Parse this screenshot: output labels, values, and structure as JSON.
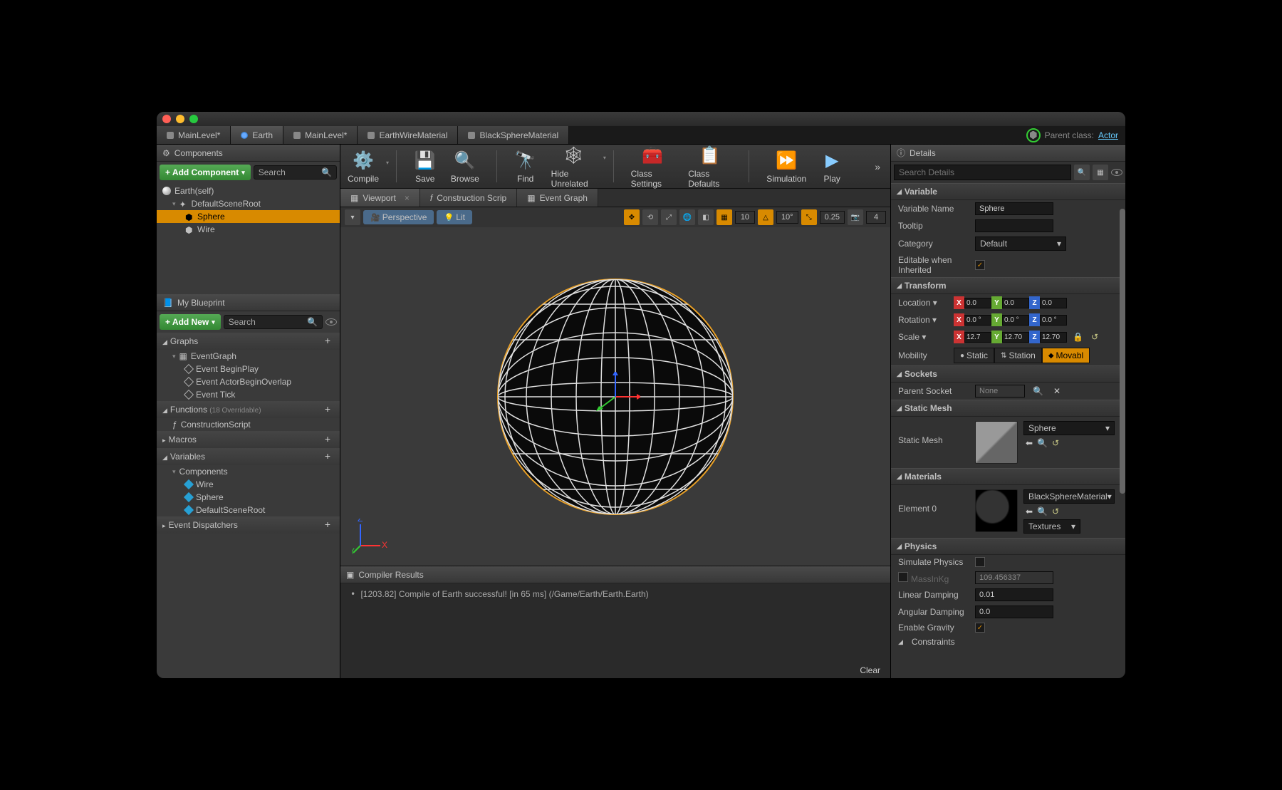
{
  "tabs": [
    "MainLevel*",
    "Earth",
    "MainLevel*",
    "EarthWireMaterial",
    "BlackSphereMaterial"
  ],
  "activeTab": 1,
  "parent": {
    "label": "Parent class:",
    "value": "Actor"
  },
  "components": {
    "title": "Components",
    "addBtn": "+ Add Component",
    "searchPlaceholder": "Search",
    "root": "Earth(self)",
    "tree": [
      "DefaultSceneRoot",
      "Sphere",
      "Wire"
    ],
    "selected": "Sphere"
  },
  "myBlueprint": {
    "title": "My Blueprint",
    "addBtn": "+ Add New",
    "searchPlaceholder": "Search",
    "sections": {
      "graphs": {
        "label": "Graphs",
        "items": [
          "EventGraph"
        ],
        "events": [
          "Event BeginPlay",
          "Event ActorBeginOverlap",
          "Event Tick"
        ]
      },
      "functions": {
        "label": "Functions",
        "note": "(18 Overridable)",
        "items": [
          "ConstructionScript"
        ]
      },
      "macros": {
        "label": "Macros"
      },
      "variables": {
        "label": "Variables",
        "sub": "Components",
        "items": [
          "Wire",
          "Sphere",
          "DefaultSceneRoot"
        ]
      },
      "dispatchers": {
        "label": "Event Dispatchers"
      }
    }
  },
  "toolbar": [
    "Compile",
    "Save",
    "Browse",
    "Find",
    "Hide Unrelated",
    "Class Settings",
    "Class Defaults",
    "Simulation",
    "Play"
  ],
  "viewTabs": [
    "Viewport",
    "Construction Scrip",
    "Event Graph"
  ],
  "vpBar": {
    "perspective": "Perspective",
    "lit": "Lit",
    "grid": "10",
    "angle": "10°",
    "scale": "0.25",
    "cam": "4"
  },
  "compiler": {
    "title": "Compiler Results",
    "msg": "[1203.82] Compile of Earth successful! [in 65 ms] (/Game/Earth/Earth.Earth)",
    "clear": "Clear"
  },
  "details": {
    "title": "Details",
    "searchPlaceholder": "Search Details",
    "variable": {
      "hdr": "Variable",
      "nameLbl": "Variable Name",
      "name": "Sphere",
      "tooltipLbl": "Tooltip",
      "tooltip": "",
      "categoryLbl": "Category",
      "category": "Default",
      "editableLbl": "Editable when Inherited"
    },
    "transform": {
      "hdr": "Transform",
      "locLbl": "Location",
      "loc": {
        "x": "0.0",
        "y": "0.0",
        "z": "0.0"
      },
      "rotLbl": "Rotation",
      "rot": {
        "x": "0.0 °",
        "y": "0.0 °",
        "z": "0.0 °"
      },
      "scaleLbl": "Scale",
      "scale": {
        "x": "12.7",
        "y": "12.70",
        "z": "12.70"
      },
      "mobilityLbl": "Mobility",
      "mobility": [
        "Static",
        "Station",
        "Movabl"
      ]
    },
    "sockets": {
      "hdr": "Sockets",
      "lbl": "Parent Socket",
      "value": "None"
    },
    "staticMesh": {
      "hdr": "Static Mesh",
      "lbl": "Static Mesh",
      "value": "Sphere"
    },
    "materials": {
      "hdr": "Materials",
      "lbl": "Element 0",
      "value": "BlackSphereMaterial",
      "textures": "Textures"
    },
    "physics": {
      "hdr": "Physics",
      "simLbl": "Simulate Physics",
      "massLbl": "MassInKg",
      "mass": "109.456337",
      "linDampLbl": "Linear Damping",
      "linDamp": "0.01",
      "angDampLbl": "Angular Damping",
      "angDamp": "0.0",
      "gravityLbl": "Enable Gravity",
      "constraintsLbl": "Constraints"
    }
  }
}
